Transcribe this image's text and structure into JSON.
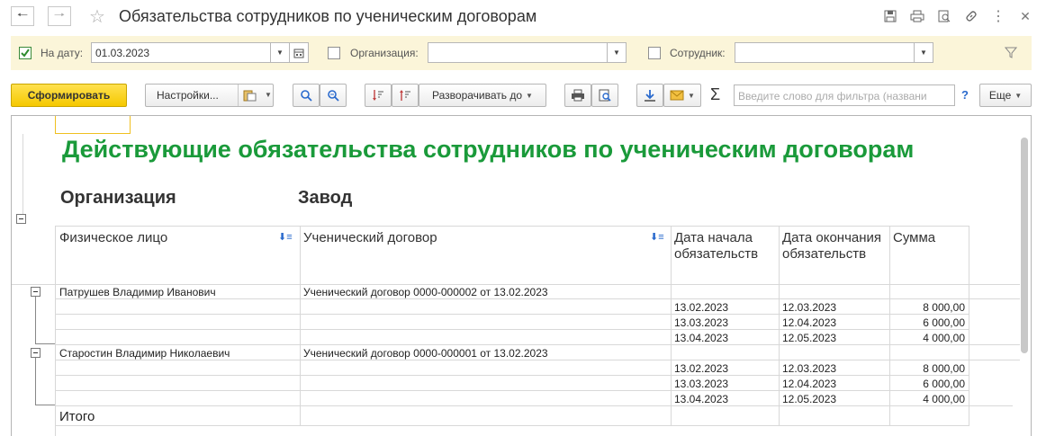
{
  "window": {
    "title": "Обязательства сотрудников по ученическим договорам"
  },
  "filters": {
    "date_label": "На дату:",
    "date_value": "01.03.2023",
    "org_label": "Организация:",
    "org_value": "",
    "emp_label": "Сотрудник:",
    "emp_value": ""
  },
  "toolbar": {
    "generate": "Сформировать",
    "settings": "Настройки...",
    "expand_to": "Разворачивать до",
    "search_placeholder": "Введите слово для фильтра (названи",
    "help": "?",
    "more": "Еще"
  },
  "report": {
    "title": "Действующие обязательства сотрудников по ученическим договорам",
    "org_label": "Организация",
    "org_value": "Завод",
    "headers": [
      "Физическое лицо",
      "Ученический договор",
      "Дата начала обязательств",
      "Дата окончания обязательств",
      "Сумма"
    ],
    "groups": [
      {
        "person": "Патрушев Владимир Иванович",
        "contract": "Ученический договор 0000-000002 от 13.02.2023",
        "rows": [
          {
            "start": "13.02.2023",
            "end": "12.03.2023",
            "sum": "8 000,00"
          },
          {
            "start": "13.03.2023",
            "end": "12.04.2023",
            "sum": "6 000,00"
          },
          {
            "start": "13.04.2023",
            "end": "12.05.2023",
            "sum": "4 000,00"
          }
        ]
      },
      {
        "person": "Старостин Владимир Николаевич",
        "contract": "Ученический договор 0000-000001 от 13.02.2023",
        "rows": [
          {
            "start": "13.02.2023",
            "end": "12.03.2023",
            "sum": "8 000,00"
          },
          {
            "start": "13.03.2023",
            "end": "12.04.2023",
            "sum": "6 000,00"
          },
          {
            "start": "13.04.2023",
            "end": "12.05.2023",
            "sum": "4 000,00"
          }
        ]
      }
    ],
    "total_label": "Итого"
  }
}
